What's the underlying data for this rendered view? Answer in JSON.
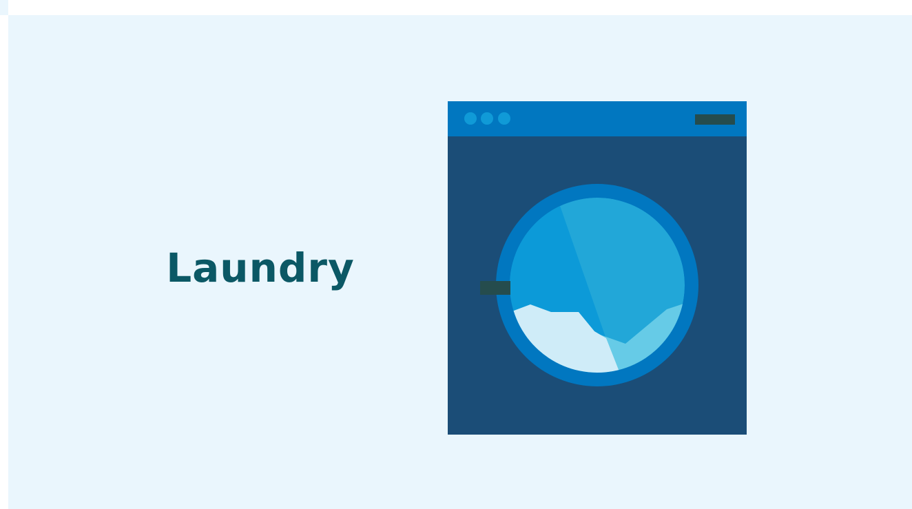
{
  "heading": {
    "text": "Laundry"
  },
  "illustration": {
    "name": "washing-machine",
    "colors": {
      "page_background": "#eaf6fd",
      "heading_text": "#0b5865",
      "machine_body": "#1b4d77",
      "control_panel": "#0177c0",
      "panel_dots": "#109ad7",
      "panel_display": "#254c4d",
      "door_ring": "#0177c0",
      "door_glass": "#22a7d8",
      "glass_shade": "#0c9ad8",
      "water_light": "#cfecf8",
      "water_mid": "#66cbe7",
      "door_handle": "#254c4d"
    }
  }
}
